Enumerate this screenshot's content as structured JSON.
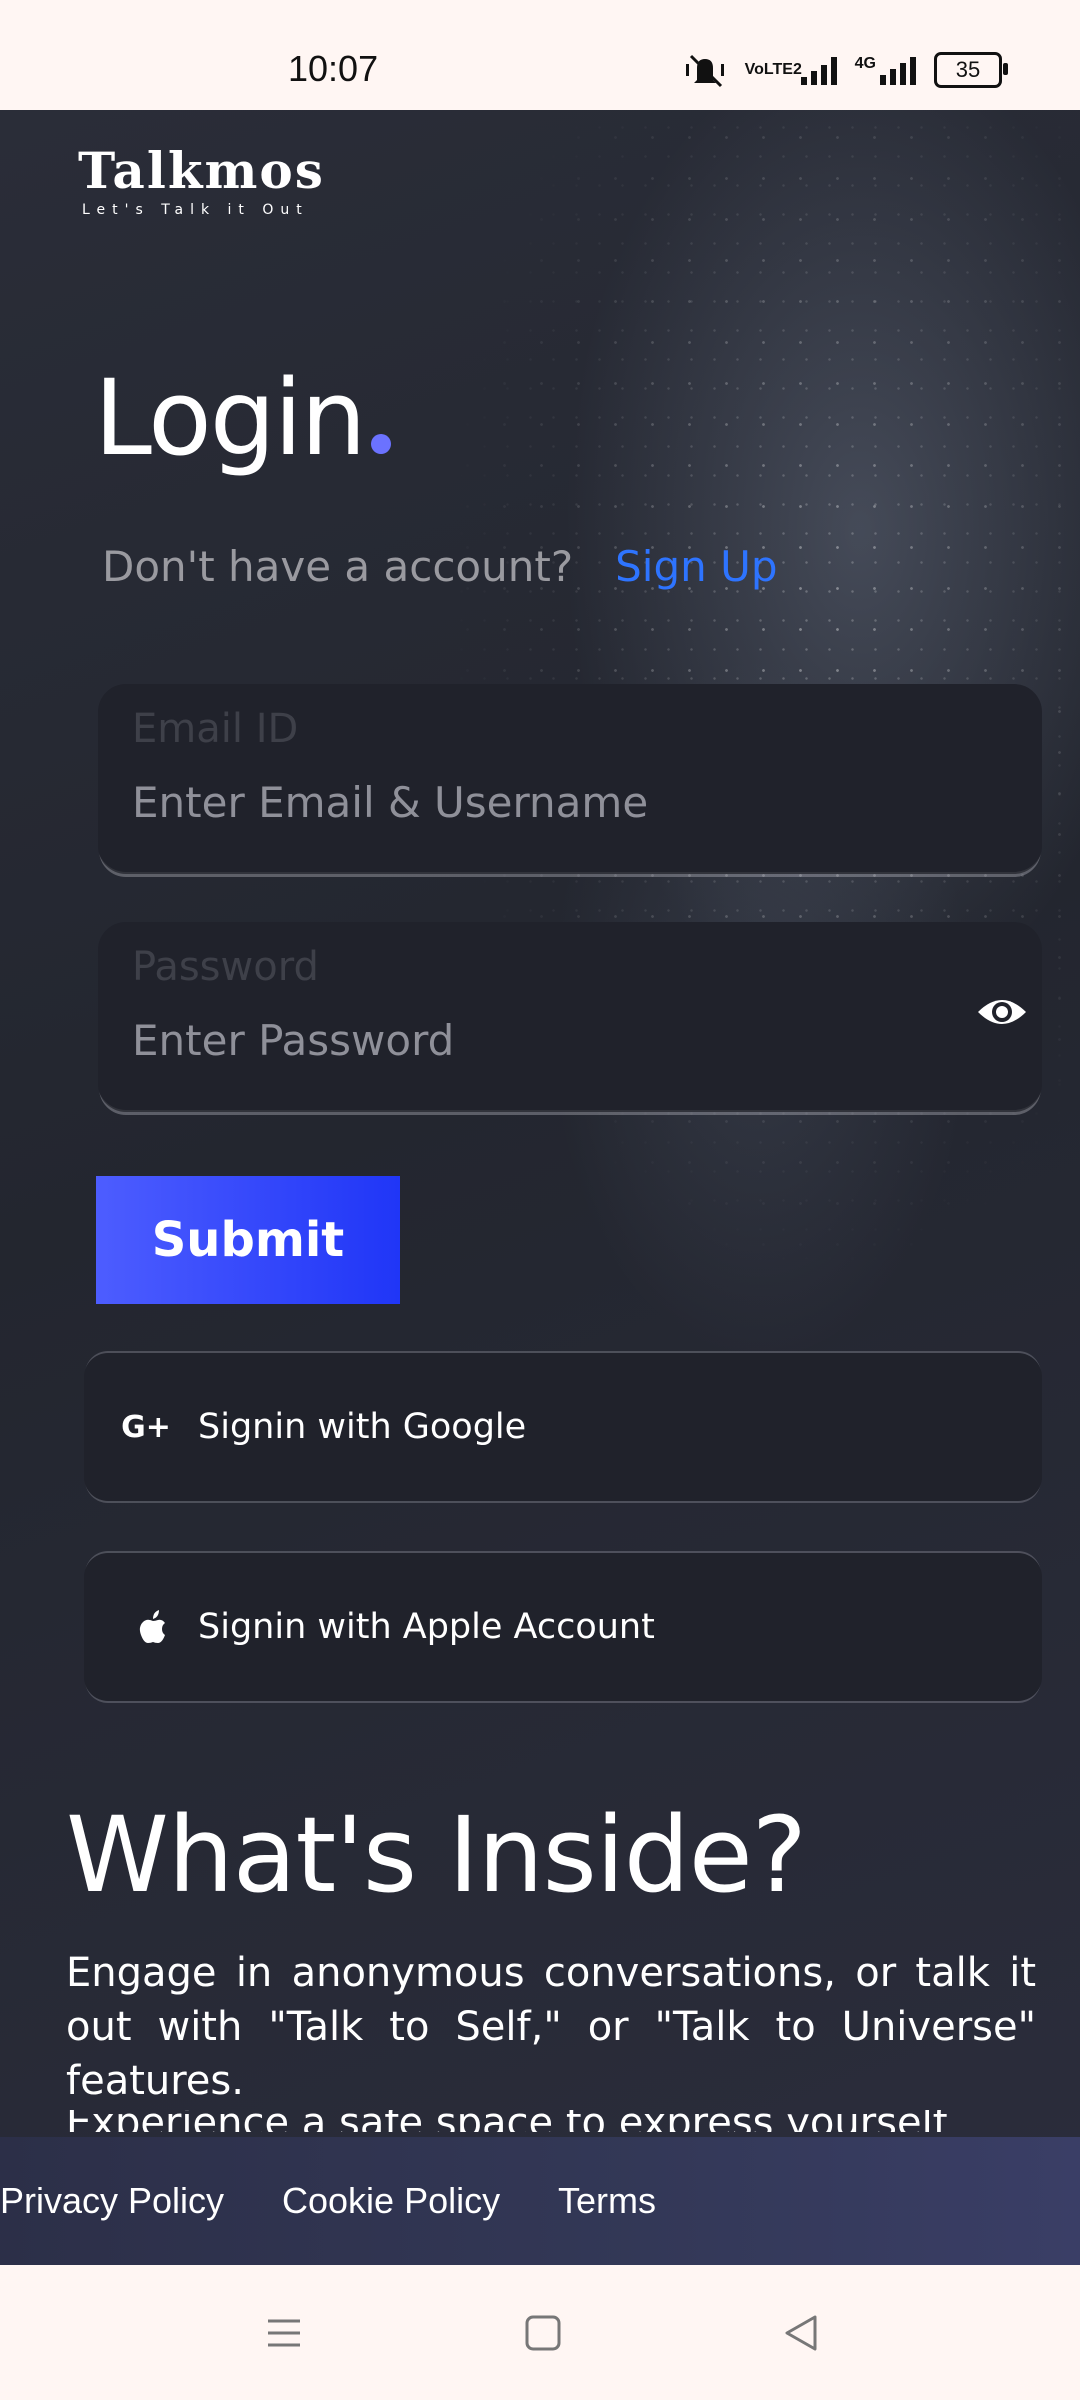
{
  "status_bar": {
    "time": "10:07",
    "network_label": "4G",
    "volte_label": "VoLTE2",
    "battery": "35",
    "icons": [
      "mute-vibrate-icon",
      "volte-icon",
      "signal-icon",
      "4g-signal-icon",
      "battery-icon"
    ]
  },
  "brand": {
    "name": "Talkmos",
    "tagline": "Let's Talk it Out"
  },
  "login": {
    "title": "Login",
    "prompt": "Don't have a account?",
    "signup_link": "Sign Up",
    "email": {
      "label": "Email ID",
      "placeholder": "Enter Email & Username"
    },
    "password": {
      "label": "Password",
      "placeholder": "Enter Password"
    },
    "submit_label": "Submit",
    "google_label": "Signin with Google",
    "google_icon_text": "G+",
    "apple_label": "Signin with Apple Account"
  },
  "whats_inside": {
    "title": "What's Inside?",
    "paragraph": "Engage in anonymous conversations, or talk it out with \"Talk to Self,\" or \"Talk to Universe\" features.",
    "paragraph_cut": "Experience a safe space to express yourself"
  },
  "footer": {
    "privacy": "Privacy Policy",
    "cookie": "Cookie Policy",
    "terms": "Terms"
  },
  "colors": {
    "accent_blue": "#2e74ff",
    "submit_gradient_start": "#4d5dff",
    "submit_gradient_end": "#2036f7",
    "field_bg": "#20222b",
    "title_dot": "#6b72ff"
  }
}
